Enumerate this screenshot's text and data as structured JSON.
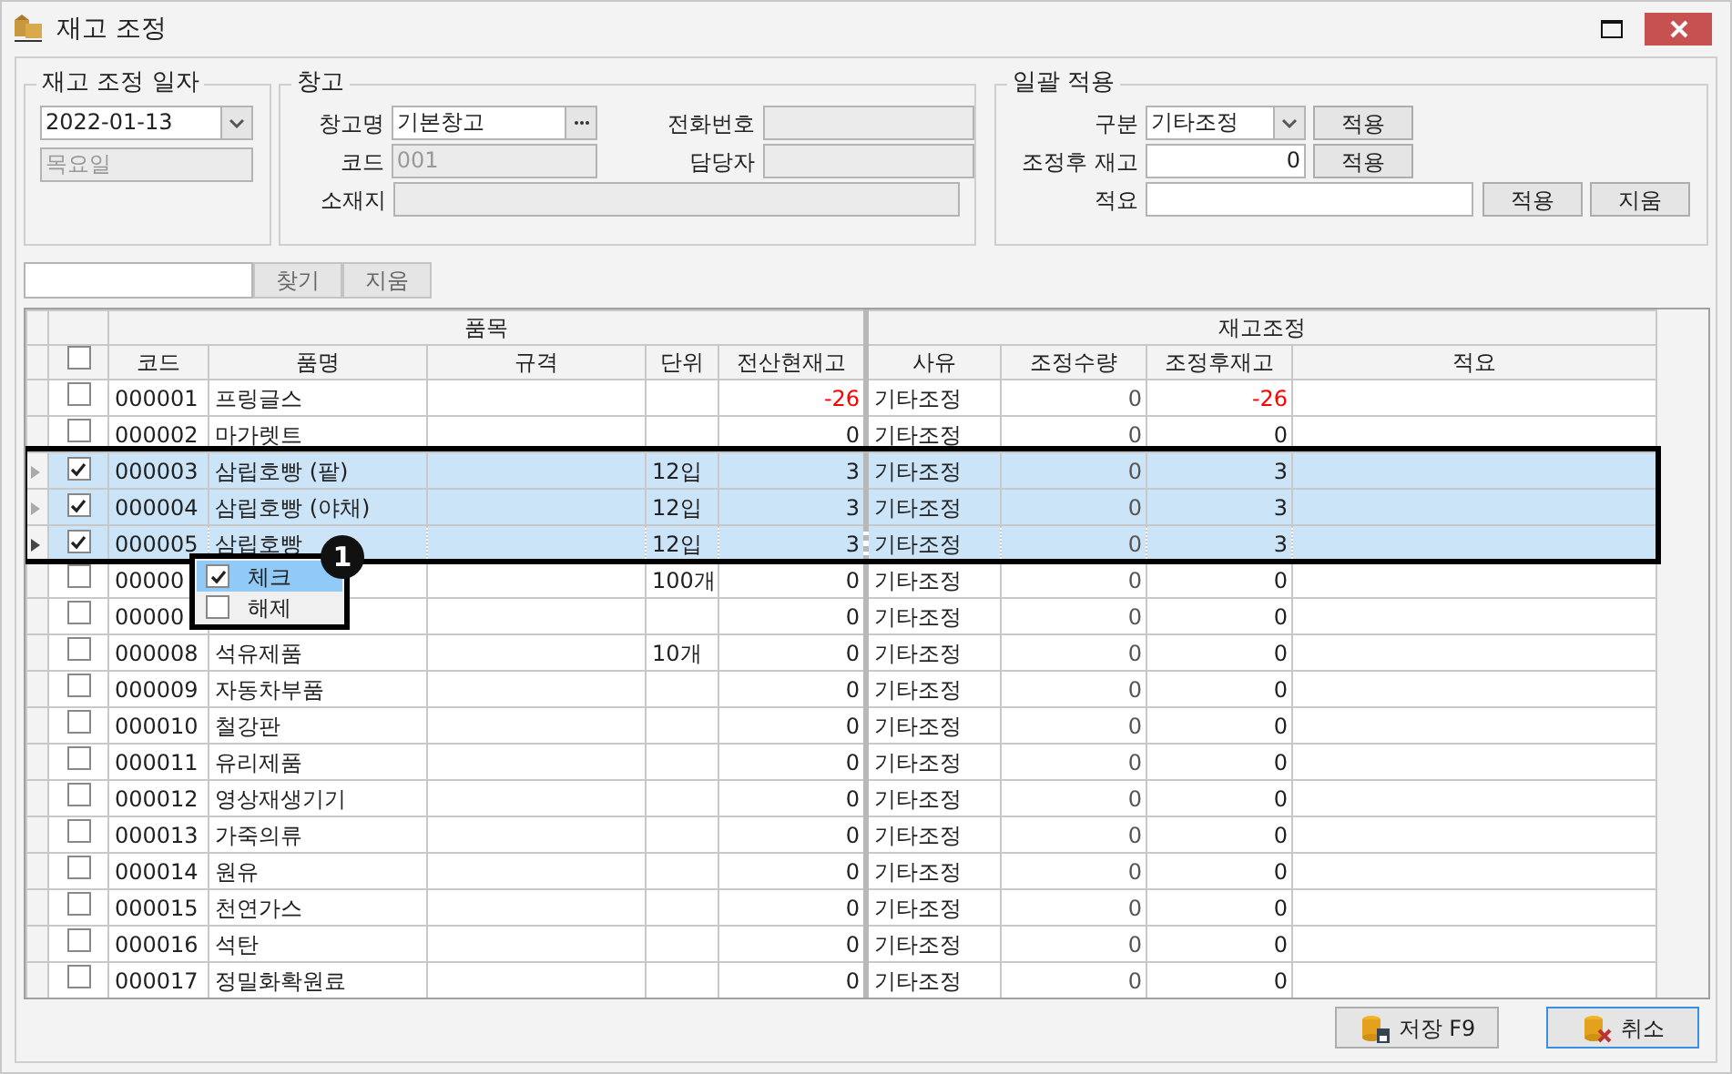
{
  "window": {
    "title": "재고 조정"
  },
  "date_group": {
    "title": "재고 조정 일자",
    "date": "2022-01-13",
    "weekday": "목요일"
  },
  "warehouse_group": {
    "title": "창고",
    "name_label": "창고명",
    "name_value": "기본창고",
    "code_label": "코드",
    "code_value": "001",
    "location_label": "소재지",
    "phone_label": "전화번호",
    "manager_label": "담당자"
  },
  "bulk_group": {
    "title": "일괄 적용",
    "type_label": "구분",
    "type_value": "기타조정",
    "type_apply": "적용",
    "after_label": "조정후 재고",
    "after_value": "0",
    "after_apply": "적용",
    "memo_label": "적요",
    "memo_apply": "적용",
    "memo_clear": "지움"
  },
  "search": {
    "find": "찾기",
    "clear": "지움"
  },
  "grid": {
    "groups": [
      "품목",
      "재고조정"
    ],
    "all_checked": false,
    "columns": [
      "코드",
      "품명",
      "규격",
      "단위",
      "전산현재고",
      "사유",
      "조정수량",
      "조정후재고",
      "적요"
    ],
    "rows": [
      {
        "selected": false,
        "current": false,
        "checked": false,
        "alert": true,
        "code": "000001",
        "name": "프링글스",
        "unit": "",
        "stock": "-26",
        "reason": "기타조정",
        "qty": "0",
        "after": "-26"
      },
      {
        "selected": false,
        "current": false,
        "checked": false,
        "alert": false,
        "code": "000002",
        "name": "마가렛트",
        "unit": "",
        "stock": "0",
        "reason": "기타조정",
        "qty": "0",
        "after": "0"
      },
      {
        "selected": true,
        "current": false,
        "checked": true,
        "alert": false,
        "code": "000003",
        "name": "삼립호빵 (팥)",
        "unit": "12입",
        "stock": "3",
        "reason": "기타조정",
        "qty": "0",
        "after": "3"
      },
      {
        "selected": true,
        "current": false,
        "checked": true,
        "alert": false,
        "code": "000004",
        "name": "삼립호빵 (야채)",
        "unit": "12입",
        "stock": "3",
        "reason": "기타조정",
        "qty": "0",
        "after": "3"
      },
      {
        "selected": true,
        "current": true,
        "checked": true,
        "alert": false,
        "code": "000005",
        "name": "삼립호빵",
        "unit": "12입",
        "stock": "3",
        "reason": "기타조정",
        "qty": "0",
        "after": "3"
      },
      {
        "selected": false,
        "current": false,
        "checked": false,
        "alert": false,
        "code": "00000",
        "name": "",
        "unit": "100개",
        "stock": "0",
        "reason": "기타조정",
        "qty": "0",
        "after": "0"
      },
      {
        "selected": false,
        "current": false,
        "checked": false,
        "alert": false,
        "code": "00000",
        "name": "",
        "unit": "",
        "stock": "0",
        "reason": "기타조정",
        "qty": "0",
        "after": "0"
      },
      {
        "selected": false,
        "current": false,
        "checked": false,
        "alert": false,
        "code": "000008",
        "name": "석유제품",
        "unit": "10개",
        "stock": "0",
        "reason": "기타조정",
        "qty": "0",
        "after": "0"
      },
      {
        "selected": false,
        "current": false,
        "checked": false,
        "alert": false,
        "code": "000009",
        "name": "자동차부품",
        "unit": "",
        "stock": "0",
        "reason": "기타조정",
        "qty": "0",
        "after": "0"
      },
      {
        "selected": false,
        "current": false,
        "checked": false,
        "alert": false,
        "code": "000010",
        "name": "철강판",
        "unit": "",
        "stock": "0",
        "reason": "기타조정",
        "qty": "0",
        "after": "0"
      },
      {
        "selected": false,
        "current": false,
        "checked": false,
        "alert": false,
        "code": "000011",
        "name": "유리제품",
        "unit": "",
        "stock": "0",
        "reason": "기타조정",
        "qty": "0",
        "after": "0"
      },
      {
        "selected": false,
        "current": false,
        "checked": false,
        "alert": false,
        "code": "000012",
        "name": "영상재생기기",
        "unit": "",
        "stock": "0",
        "reason": "기타조정",
        "qty": "0",
        "after": "0"
      },
      {
        "selected": false,
        "current": false,
        "checked": false,
        "alert": false,
        "code": "000013",
        "name": "가죽의류",
        "unit": "",
        "stock": "0",
        "reason": "기타조정",
        "qty": "0",
        "after": "0"
      },
      {
        "selected": false,
        "current": false,
        "checked": false,
        "alert": false,
        "code": "000014",
        "name": "원유",
        "unit": "",
        "stock": "0",
        "reason": "기타조정",
        "qty": "0",
        "after": "0"
      },
      {
        "selected": false,
        "current": false,
        "checked": false,
        "alert": false,
        "code": "000015",
        "name": "천연가스",
        "unit": "",
        "stock": "0",
        "reason": "기타조정",
        "qty": "0",
        "after": "0"
      },
      {
        "selected": false,
        "current": false,
        "checked": false,
        "alert": false,
        "code": "000016",
        "name": "석탄",
        "unit": "",
        "stock": "0",
        "reason": "기타조정",
        "qty": "0",
        "after": "0"
      },
      {
        "selected": false,
        "current": false,
        "checked": false,
        "alert": false,
        "code": "000017",
        "name": "정밀화확원료",
        "unit": "",
        "stock": "0",
        "reason": "기타조정",
        "qty": "0",
        "after": "0"
      }
    ]
  },
  "context_menu": {
    "items": [
      {
        "label": "체크",
        "checked": true,
        "selected": true
      },
      {
        "label": "해제",
        "checked": false,
        "selected": false
      }
    ]
  },
  "annotation": {
    "badge": "1"
  },
  "footer": {
    "save": "저장 F9",
    "cancel": "취소"
  }
}
